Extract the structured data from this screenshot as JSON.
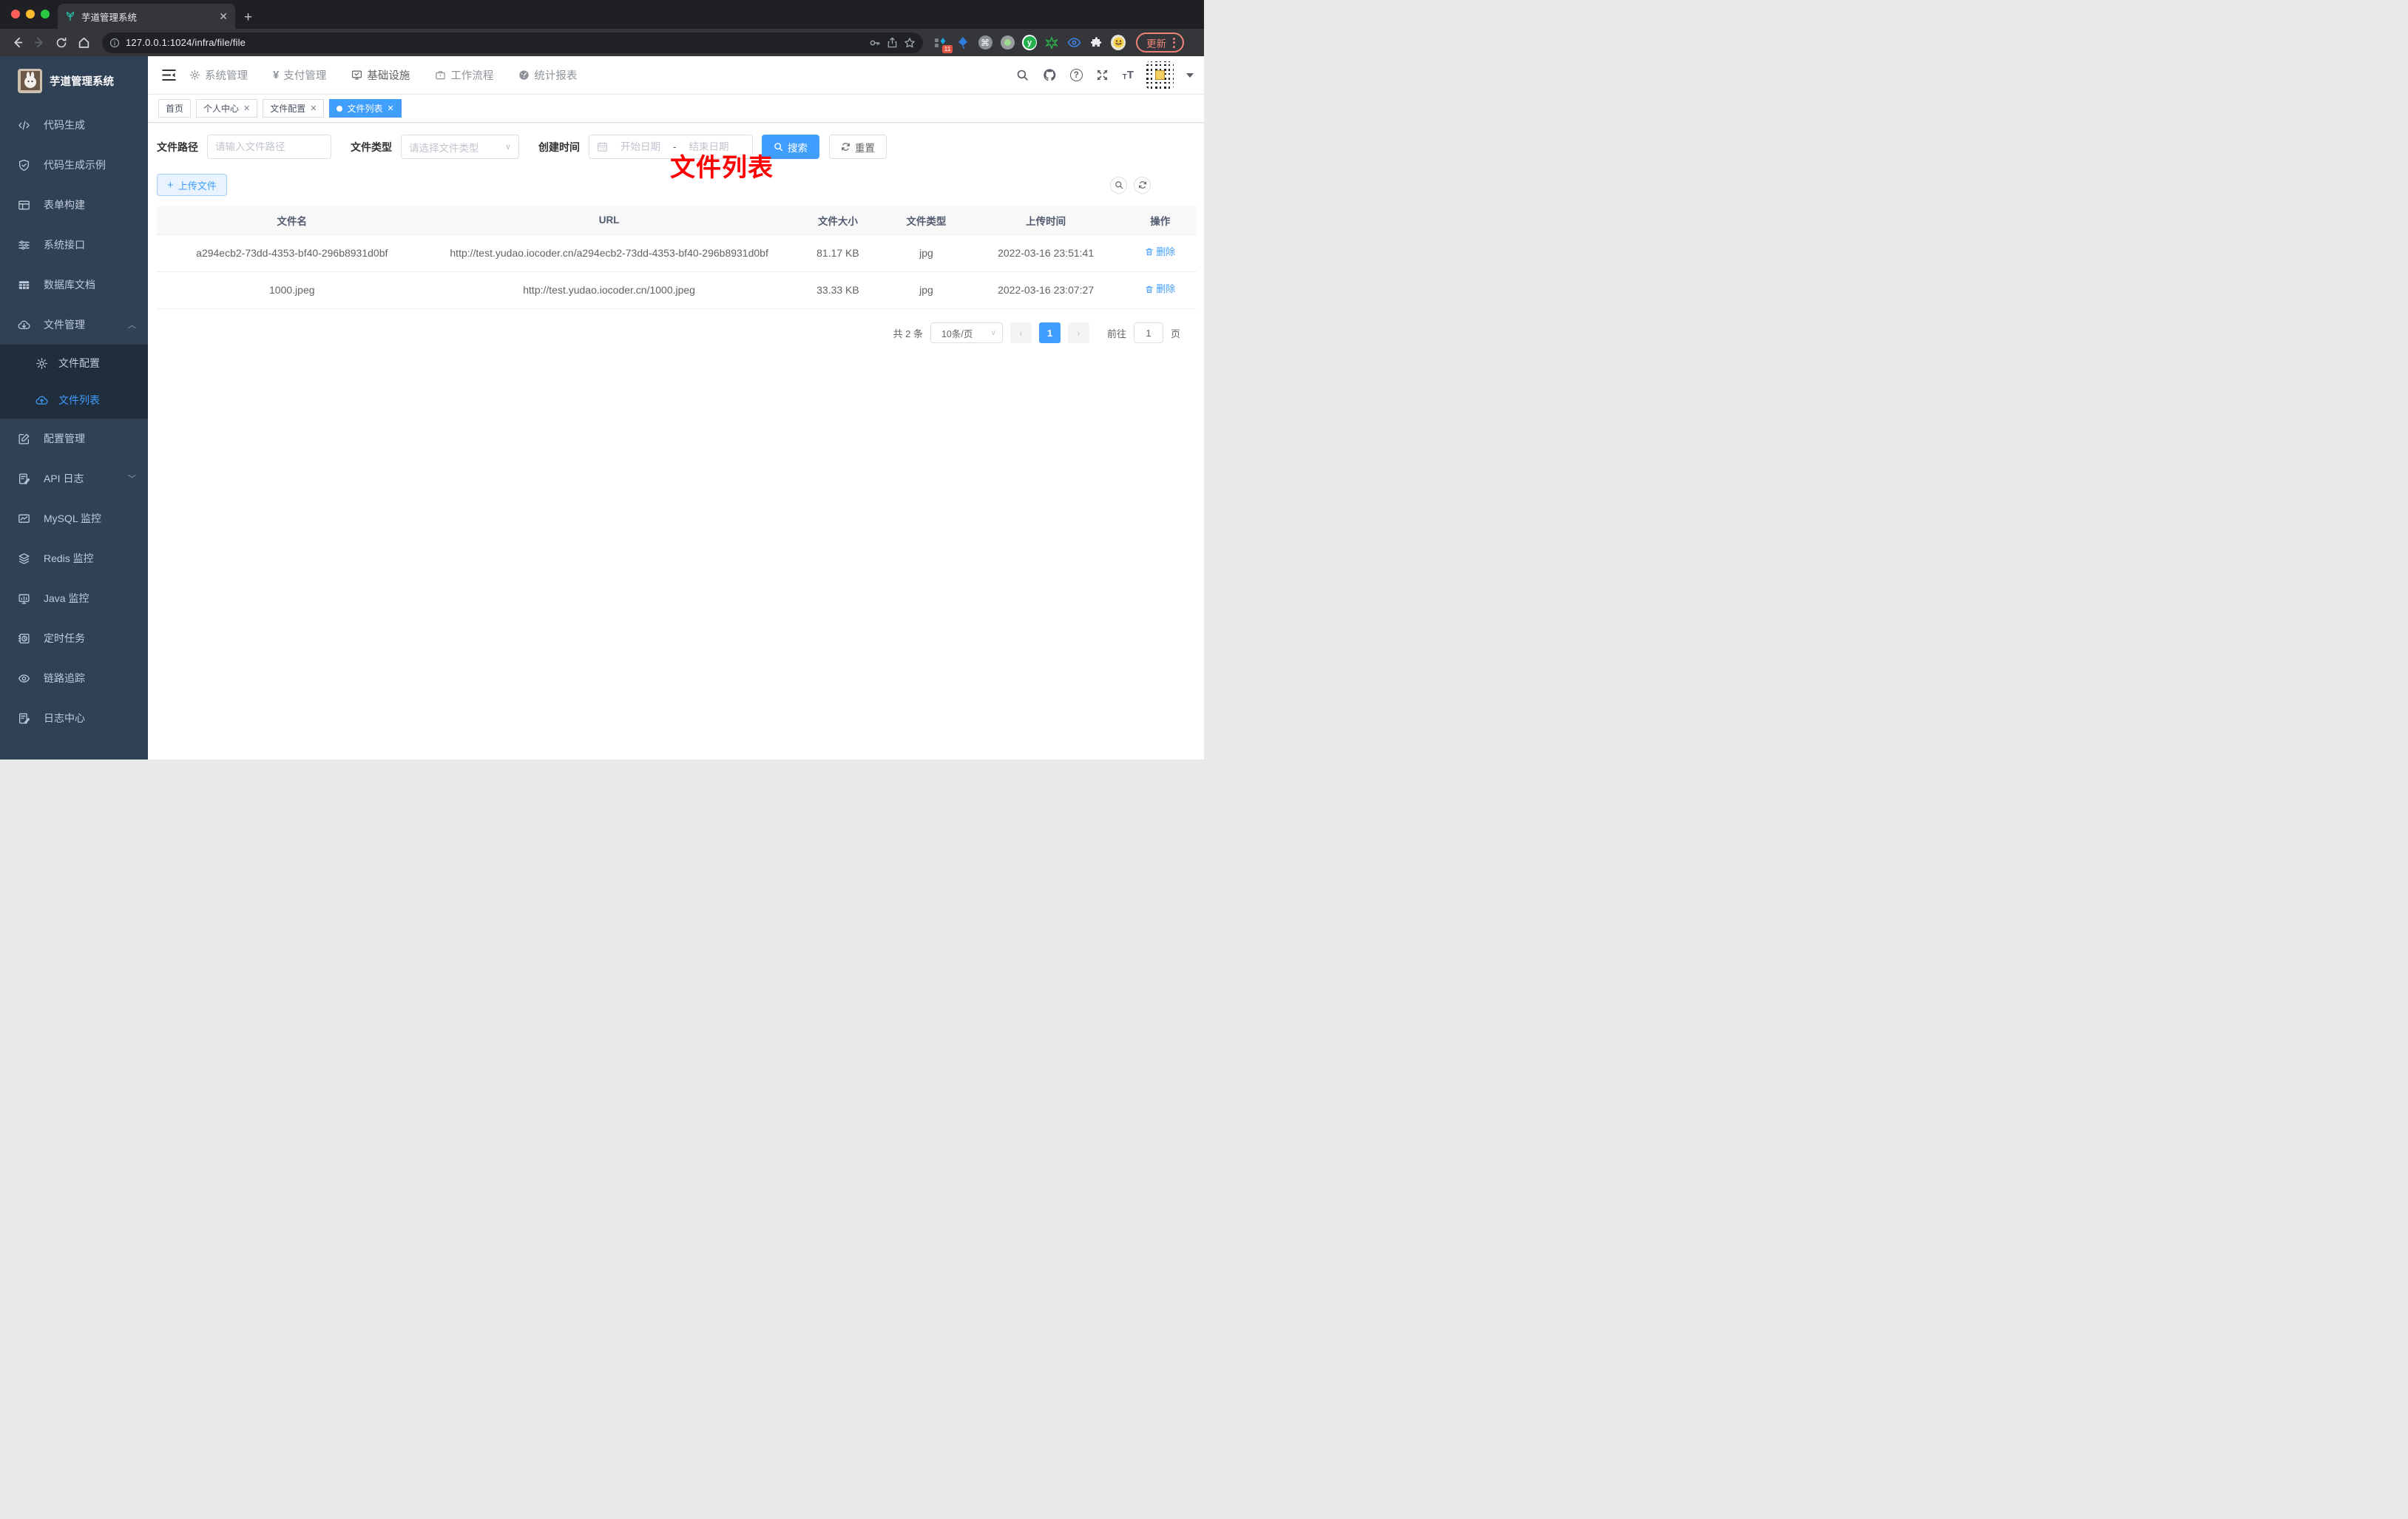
{
  "browser": {
    "tab_title": "芋道管理系统",
    "url": "127.0.0.1:1024/infra/file/file",
    "update_label": "更新",
    "extension_badge": "11"
  },
  "sidebar": {
    "title": "芋道管理系统",
    "items": [
      {
        "label": "代码生成",
        "icon": "code-icon"
      },
      {
        "label": "代码生成示例",
        "icon": "shield-check-icon"
      },
      {
        "label": "表单构建",
        "icon": "form-grid-icon"
      },
      {
        "label": "系统接口",
        "icon": "sliders-icon"
      },
      {
        "label": "数据库文档",
        "icon": "database-table-icon"
      },
      {
        "label": "文件管理",
        "icon": "cloud-download-icon",
        "expanded": true
      },
      {
        "label": "配置管理",
        "icon": "edit-square-icon"
      },
      {
        "label": "API 日志",
        "icon": "log-edit-icon",
        "collapsed": true
      },
      {
        "label": "MySQL 监控",
        "icon": "mysql-monitor-icon"
      },
      {
        "label": "Redis 监控",
        "icon": "layers-icon"
      },
      {
        "label": "Java 监控",
        "icon": "java-monitor-icon"
      },
      {
        "label": "定时任务",
        "icon": "schedule-icon"
      },
      {
        "label": "链路追踪",
        "icon": "eye-icon"
      },
      {
        "label": "日志中心",
        "icon": "log-center-icon"
      }
    ],
    "submenu": [
      {
        "label": "文件配置",
        "icon": "gear-icon"
      },
      {
        "label": "文件列表",
        "icon": "cloud-upload-icon",
        "active": true
      }
    ]
  },
  "header": {
    "nav": [
      {
        "label": "系统管理",
        "icon": "gear-icon"
      },
      {
        "label": "支付管理",
        "icon": "yen-icon"
      },
      {
        "label": "基础设施",
        "icon": "monitor-check-icon",
        "active": true
      },
      {
        "label": "工作流程",
        "icon": "briefcase-icon"
      },
      {
        "label": "统计报表",
        "icon": "dashboard-icon"
      }
    ]
  },
  "tags": [
    {
      "label": "首页",
      "closable": false
    },
    {
      "label": "个人中心",
      "closable": true
    },
    {
      "label": "文件配置",
      "closable": true
    },
    {
      "label": "文件列表",
      "closable": true,
      "active": true
    }
  ],
  "annotation": "文件列表",
  "filters": {
    "path_label": "文件路径",
    "path_placeholder": "请输入文件路径",
    "type_label": "文件类型",
    "type_placeholder": "请选择文件类型",
    "date_label": "创建时间",
    "date_start_placeholder": "开始日期",
    "date_separator": "-",
    "date_end_placeholder": "结束日期",
    "search_label": "搜索",
    "reset_label": "重置"
  },
  "toolbar": {
    "upload_label": "上传文件"
  },
  "table": {
    "columns": [
      "文件名",
      "URL",
      "文件大小",
      "文件类型",
      "上传时间",
      "操作"
    ],
    "rows": [
      {
        "name": "a294ecb2-73dd-4353-bf40-296b8931d0bf",
        "url": "http://test.yudao.iocoder.cn/a294ecb2-73dd-4353-bf40-296b8931d0bf",
        "size": "81.17 KB",
        "type": "jpg",
        "time": "2022-03-16 23:51:41",
        "action": "删除"
      },
      {
        "name": "1000.jpeg",
        "url": "http://test.yudao.iocoder.cn/1000.jpeg",
        "size": "33.33 KB",
        "type": "jpg",
        "time": "2022-03-16 23:07:27",
        "action": "删除"
      }
    ]
  },
  "pagination": {
    "total": "共 2 条",
    "page_size": "10条/页",
    "current_page": "1",
    "goto_label": "前往",
    "goto_value": "1",
    "page_unit": "页"
  },
  "colors": {
    "primary": "#409eff",
    "sidebar_bg": "#304156",
    "submenu_bg": "#1f2d3d",
    "annotation_red": "#fe0000",
    "update_pill": "#ee8277"
  }
}
